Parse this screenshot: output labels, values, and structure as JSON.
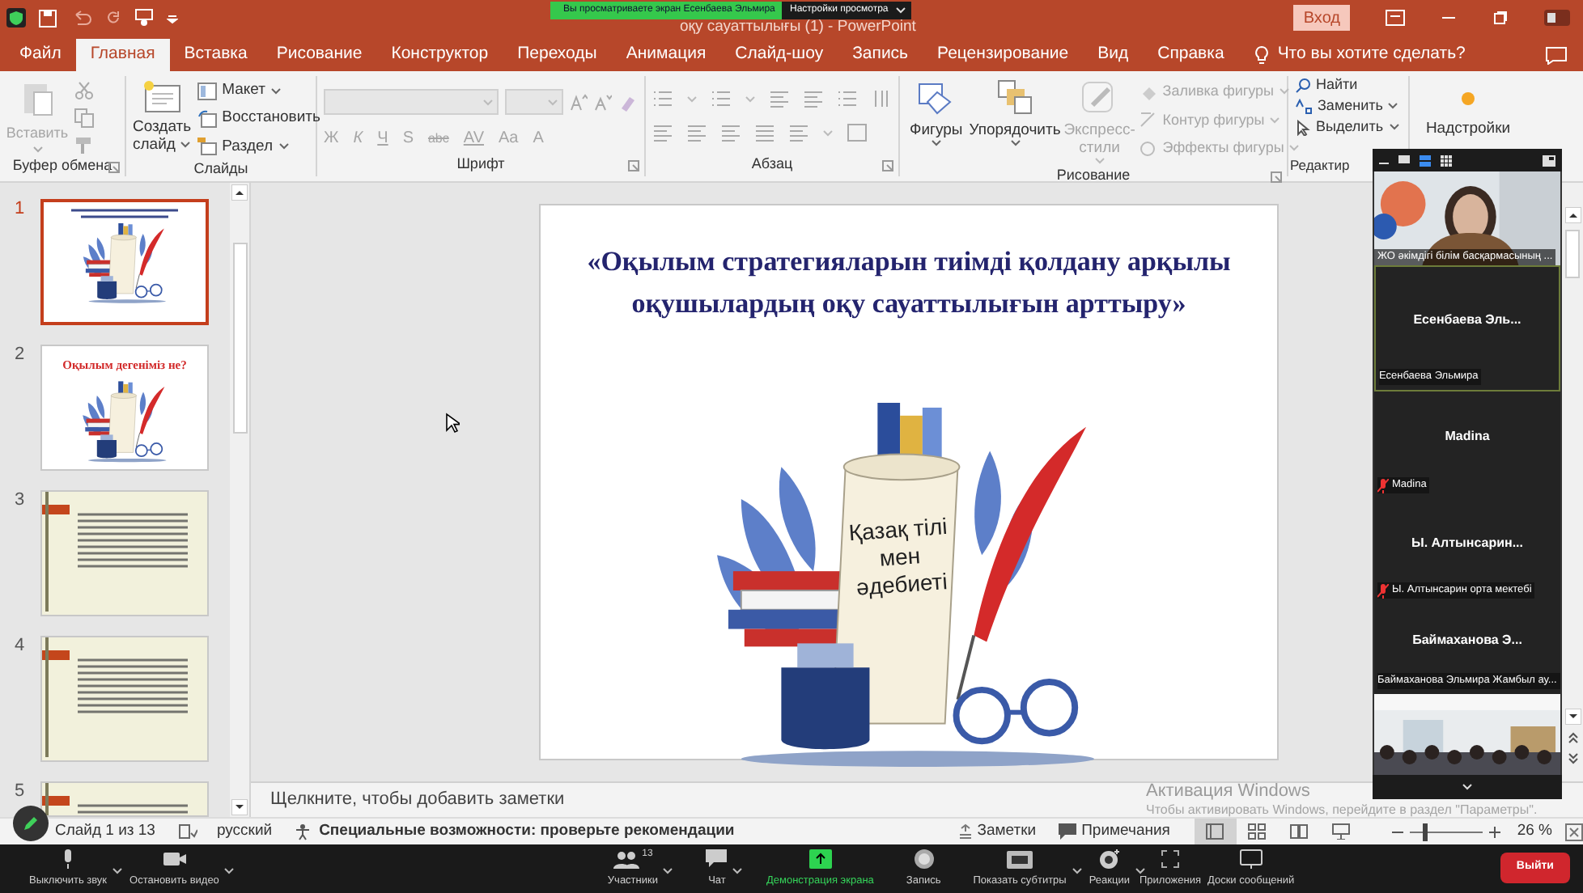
{
  "title_bar": {
    "title": "оқу сауаттылығы (1)  -  PowerPoint",
    "sign_in": "Вход"
  },
  "share_banner": {
    "message": "Вы просматриваете экран Есенбаева Эльмира",
    "options": "Настройки просмотра"
  },
  "tabs": [
    {
      "label": "Файл",
      "selected": false
    },
    {
      "label": "Главная",
      "selected": true
    },
    {
      "label": "Вставка",
      "selected": false
    },
    {
      "label": "Рисование",
      "selected": false
    },
    {
      "label": "Конструктор",
      "selected": false
    },
    {
      "label": "Переходы",
      "selected": false
    },
    {
      "label": "Анимация",
      "selected": false
    },
    {
      "label": "Слайд-шоу",
      "selected": false
    },
    {
      "label": "Запись",
      "selected": false
    },
    {
      "label": "Рецензирование",
      "selected": false
    },
    {
      "label": "Вид",
      "selected": false
    },
    {
      "label": "Справка",
      "selected": false
    }
  ],
  "tell_me": {
    "placeholder": "Что вы хотите сделать?"
  },
  "ribbon": {
    "clipboard": {
      "label": "Буфер обмена",
      "paste": {
        "label": "Вставить",
        "disabled": true
      }
    },
    "slides": {
      "label": "Слайды",
      "new_slide": "Создать слайд",
      "items": [
        "Макет",
        "Восстановить",
        "Раздел"
      ]
    },
    "font": {
      "label": "Шрифт",
      "disabled": true,
      "buttons": [
        "Ж",
        "К",
        "Ч",
        "S",
        "abc",
        "AV",
        "Aa",
        "A"
      ]
    },
    "paragraph": {
      "label": "Абзац"
    },
    "drawing": {
      "label": "Рисование",
      "large": [
        {
          "label": "Фигуры",
          "disabled": false
        },
        {
          "label": "Упорядочить",
          "disabled": false
        },
        {
          "label": "Экспресс-стили",
          "disabled": true
        }
      ],
      "format": [
        {
          "label": "Заливка фигуры",
          "disabled": true
        },
        {
          "label": "Контур фигуры",
          "disabled": true
        },
        {
          "label": "Эффекты фигуры",
          "disabled": true
        }
      ]
    },
    "editing": {
      "label": "Редактир",
      "items": [
        "Найти",
        "Заменить",
        "Выделить"
      ]
    },
    "addins": {
      "label": "Надстройки"
    }
  },
  "thumbnails": [
    {
      "number": "1",
      "selected": true,
      "kind": "title"
    },
    {
      "number": "2",
      "selected": false,
      "kind": "heading",
      "heading": "Оқылым дегеніміз не?"
    },
    {
      "number": "3",
      "selected": false,
      "kind": "text"
    },
    {
      "number": "4",
      "selected": false,
      "kind": "text"
    },
    {
      "number": "5",
      "selected": false,
      "kind": "text"
    }
  ],
  "slide": {
    "title": "«Оқылым стратегияларын тиімді қолдану арқылы оқушылардың оқу сауаттылығын арттыру»",
    "scroll_text": "Қазақ тілі мен әдебиеті"
  },
  "notes": {
    "placeholder": "Щелкните, чтобы добавить заметки"
  },
  "activation": {
    "title": "Активация Windows",
    "hint": "Чтобы активировать Windows, перейдите в раздел \"Параметры\"."
  },
  "meeting_panel": {
    "tiles": [
      {
        "kind": "video",
        "caption": "ЖО әкімдігі білім басқармасының ...",
        "muted": false,
        "speaking": false
      },
      {
        "kind": "name",
        "name": "Есенбаева  Эль...",
        "caption": "Есенбаева Эльмира",
        "muted": false,
        "speaking": true
      },
      {
        "kind": "name",
        "name": "Madina",
        "caption": "Madina",
        "muted": true,
        "speaking": false
      },
      {
        "kind": "name",
        "name": "Ы.  Алтынсарин...",
        "caption": "Ы. Алтынсарин орта мектебі",
        "muted": true,
        "speaking": false
      },
      {
        "kind": "name",
        "name": "Баймаханова  Э...",
        "caption": "Баймаханова Эльмира Жамбыл ау...",
        "muted": false,
        "speaking": false
      },
      {
        "kind": "video",
        "muted": false,
        "speaking": false
      }
    ]
  },
  "status_bar": {
    "slide_counter": "Слайд 1 из 13",
    "language": "русский",
    "accessibility": "Специальные возможности: проверьте рекомендации",
    "notes": "Заметки",
    "comments": "Примечания",
    "views": [
      {
        "selected": true
      },
      {
        "selected": false
      },
      {
        "selected": false
      },
      {
        "selected": false
      }
    ],
    "zoom": {
      "level": 0.2,
      "reading": "26 %"
    }
  },
  "meeting_toolbar": {
    "controls": [
      {
        "label": "Выключить звук",
        "selected": false
      },
      {
        "label": "Остановить видео",
        "selected": false
      },
      {
        "label": "Участники",
        "count": "13",
        "selected": false
      },
      {
        "label": "Чат",
        "selected": false
      },
      {
        "label": "Демонстрация экрана",
        "selected": true
      },
      {
        "label": "Запись",
        "selected": false
      },
      {
        "label": "Показать субтитры",
        "selected": false
      },
      {
        "label": "Реакции",
        "selected": false
      },
      {
        "label": "Приложения",
        "selected": false
      },
      {
        "label": "Доски сообщений",
        "selected": false
      }
    ],
    "leave": "Выйти"
  }
}
